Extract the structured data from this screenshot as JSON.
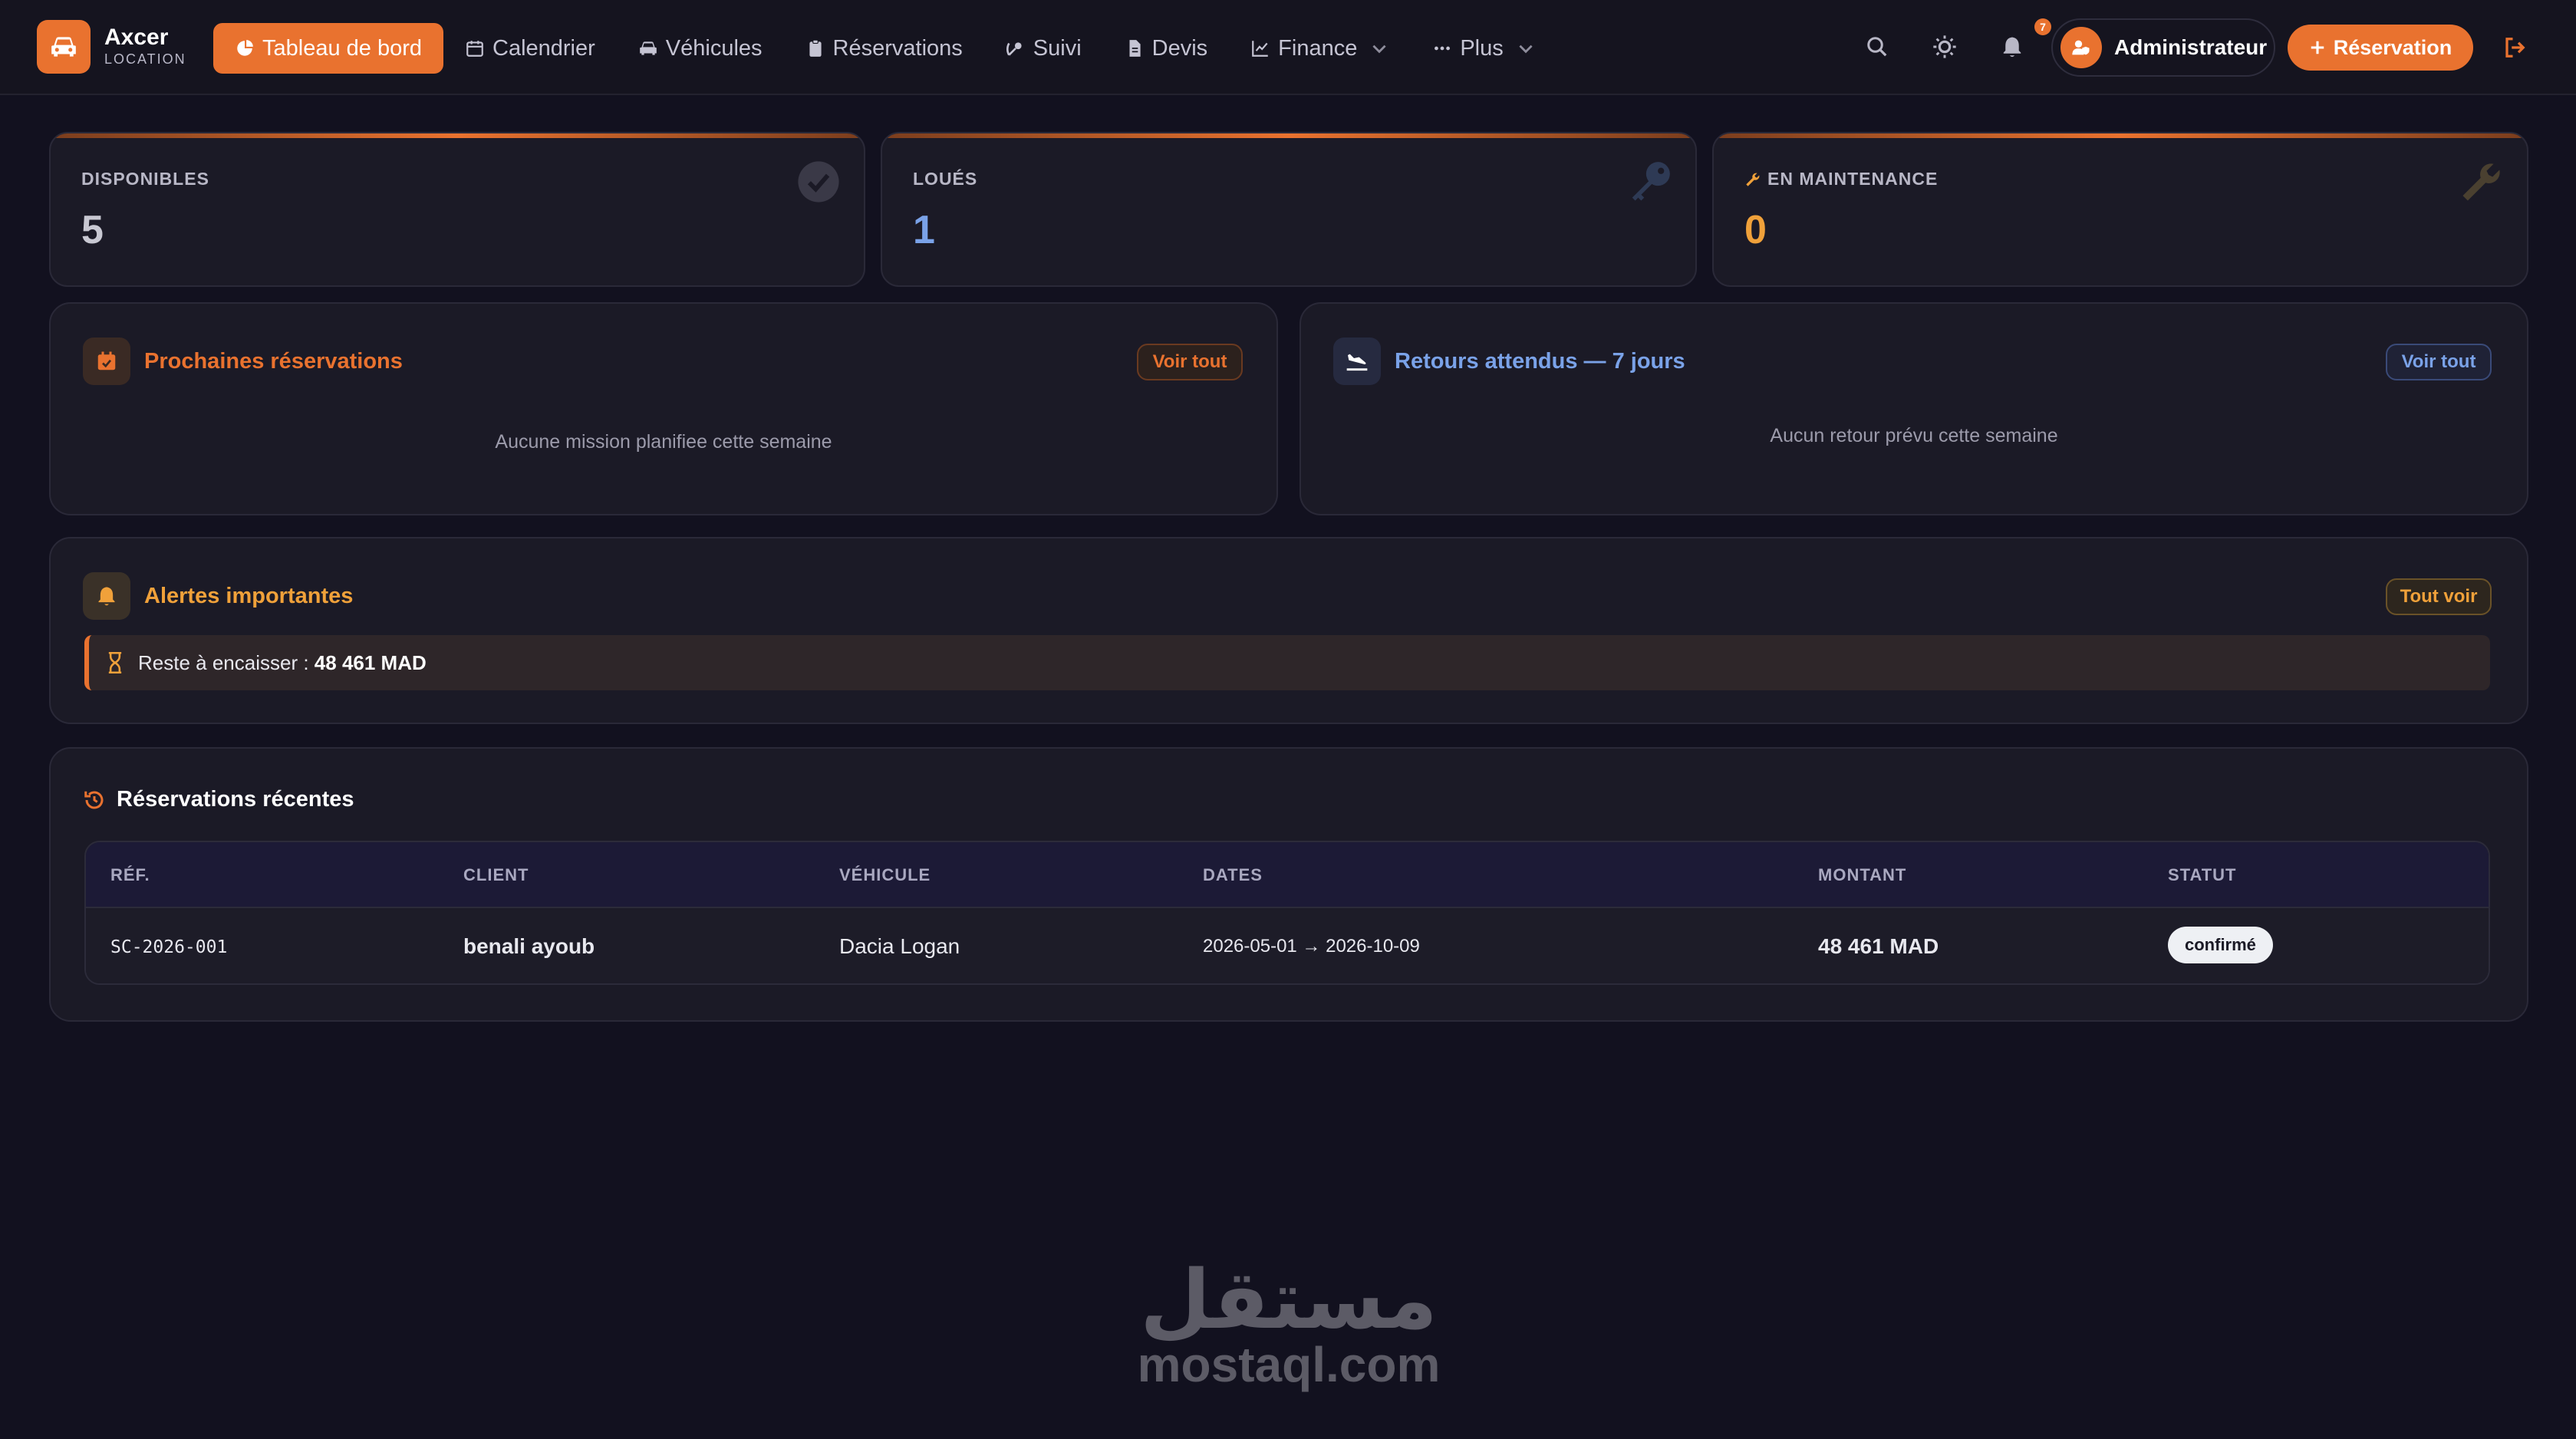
{
  "brand": {
    "name": "Axcer",
    "subtitle": "LOCATION"
  },
  "nav": {
    "items": [
      {
        "label": "Tableau de bord",
        "icon": "dashboard-icon",
        "active": true
      },
      {
        "label": "Calendrier",
        "icon": "calendar-icon"
      },
      {
        "label": "Véhicules",
        "icon": "car-icon"
      },
      {
        "label": "Réservations",
        "icon": "clipboard-icon"
      },
      {
        "label": "Suivi",
        "icon": "satellite-icon"
      },
      {
        "label": "Devis",
        "icon": "document-icon"
      },
      {
        "label": "Finance",
        "icon": "chart-line-icon",
        "dropdown": true
      },
      {
        "label": "Plus",
        "icon": "ellipsis-icon",
        "dropdown": true
      }
    ]
  },
  "header": {
    "notifications_count": "7",
    "user_label": "Administrateur",
    "new_reservation_label": "Réservation"
  },
  "stats": [
    {
      "label": "DISPONIBLES",
      "value": "5",
      "icon": "check-circle-icon",
      "color": "#c8c8d2"
    },
    {
      "label": "LOUÉS",
      "value": "1",
      "icon": "key-icon",
      "color": "#7aa2e8"
    },
    {
      "label": "EN MAINTENANCE",
      "value": "0",
      "icon": "wrench-icon",
      "color": "#f0a13a"
    }
  ],
  "upcoming": {
    "title": "Prochaines réservations",
    "button": "Voir tout",
    "empty": "Aucune mission planifiee cette semaine"
  },
  "returns": {
    "title": "Retours attendus — 7 jours",
    "button": "Voir tout",
    "empty": "Aucun retour prévu cette semaine"
  },
  "alerts": {
    "title": "Alertes importantes",
    "button": "Tout voir",
    "items": [
      {
        "label": "Reste à encaisser :",
        "value": "48 461 MAD"
      }
    ]
  },
  "recent": {
    "title": "Réservations récentes",
    "columns": [
      "RÉF.",
      "CLIENT",
      "VÉHICULE",
      "DATES",
      "MONTANT",
      "STATUT"
    ],
    "rows": [
      {
        "ref": "SC-2026-001",
        "client": "benali ayoub",
        "vehicle": "Dacia Logan",
        "dates": "2026-05-01 → 2026-10-09",
        "amount": "48 461 MAD",
        "status": "confirmé"
      }
    ]
  },
  "watermark": {
    "arabic": "مستقل",
    "latin": "mostaql.com"
  },
  "colors": {
    "accent": "#e9722f",
    "blue": "#7aa2e8",
    "amber": "#f0a13a",
    "background": "#12111f",
    "card": "#1b1a26"
  }
}
